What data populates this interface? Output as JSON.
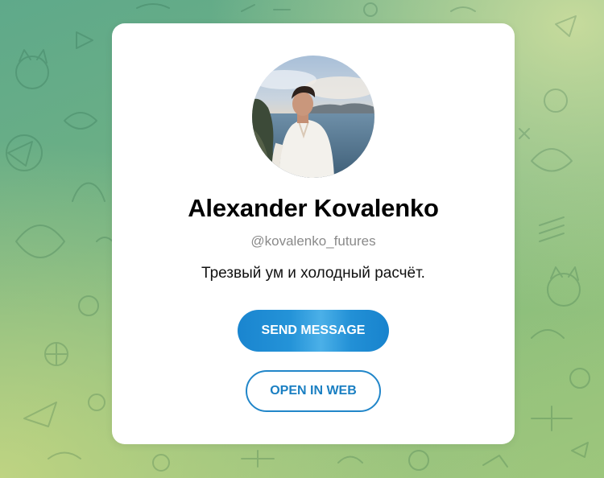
{
  "profile": {
    "name": "Alexander Kovalenko",
    "username": "@kovalenko_futures",
    "bio": "Трезвый ум и холодный расчёт."
  },
  "actions": {
    "send_message_label": "SEND MESSAGE",
    "open_in_web_label": "OPEN IN WEB"
  },
  "colors": {
    "accent": "#2481cc",
    "background_green": "#6fb184",
    "card": "#ffffff"
  },
  "icons": {
    "avatar": "profile-photo",
    "background": "doodle-pattern"
  }
}
